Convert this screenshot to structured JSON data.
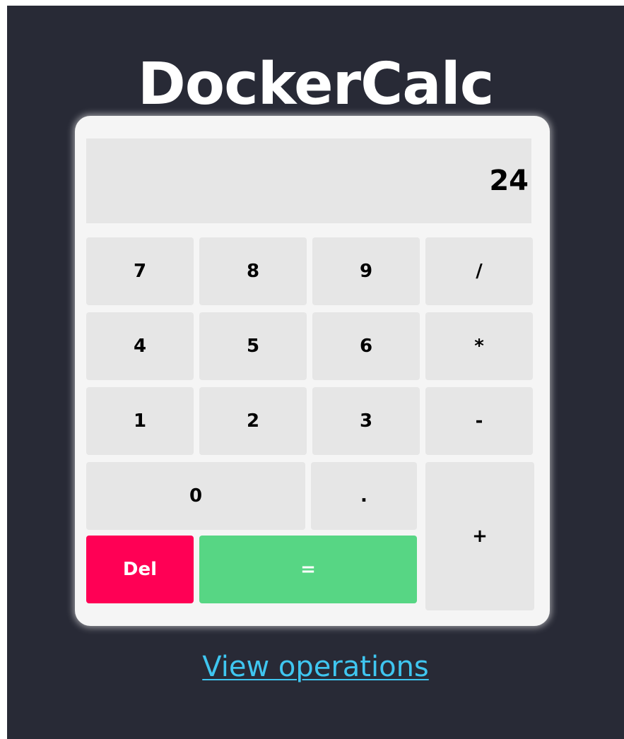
{
  "app": {
    "title": "DockerCalc"
  },
  "display": {
    "value": "24"
  },
  "keys": {
    "k7": "7",
    "k8": "8",
    "k9": "9",
    "divide": "/",
    "k4": "4",
    "k5": "5",
    "k6": "6",
    "multiply": "*",
    "k1": "1",
    "k2": "2",
    "k3": "3",
    "minus": "-",
    "k0": "0",
    "decimal": ".",
    "plus": "+",
    "del": "Del",
    "equals": "="
  },
  "footer": {
    "link_label": "View operations"
  },
  "colors": {
    "background": "#282a36",
    "panel": "#f5f5f5",
    "key": "#e6e6e6",
    "delete": "#ff0055",
    "equals": "#57d684",
    "link": "#3fc6f0"
  }
}
